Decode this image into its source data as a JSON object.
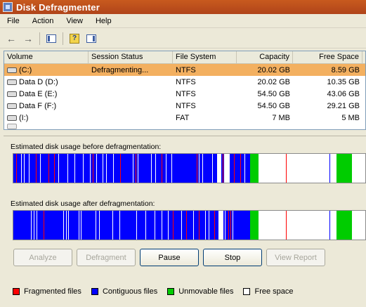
{
  "window": {
    "title": "Disk Defragmenter"
  },
  "menu": [
    "File",
    "Action",
    "View",
    "Help"
  ],
  "toolbar": {
    "icons": [
      "back-arrow-icon",
      "forward-arrow-icon",
      "show-hide-console-tree-icon",
      "help-icon",
      "properties-icon"
    ]
  },
  "table": {
    "columns": [
      "Volume",
      "Session Status",
      "File System",
      "Capacity",
      "Free Space"
    ],
    "rows": [
      {
        "volume": "(C:)",
        "status": "Defragmenting...",
        "fs": "NTFS",
        "capacity": "20.02 GB",
        "free": "8.59 GB",
        "selected": true
      },
      {
        "volume": "Data D (D:)",
        "status": "",
        "fs": "NTFS",
        "capacity": "20.02 GB",
        "free": "10.35 GB",
        "selected": false
      },
      {
        "volume": "Data E (E:)",
        "status": "",
        "fs": "NTFS",
        "capacity": "54.50 GB",
        "free": "43.06 GB",
        "selected": false
      },
      {
        "volume": "Data F (F:)",
        "status": "",
        "fs": "NTFS",
        "capacity": "54.50 GB",
        "free": "29.21 GB",
        "selected": false
      },
      {
        "volume": "(I:)",
        "status": "",
        "fs": "FAT",
        "capacity": "7 MB",
        "free": "5 MB",
        "selected": false
      }
    ]
  },
  "before_label": "Estimated disk usage before defragmentation:",
  "after_label": "Estimated disk usage after defragmentation:",
  "buttons": {
    "analyze": "Analyze",
    "defragment": "Defragment",
    "pause": "Pause",
    "stop": "Stop",
    "view_report": "View Report"
  },
  "legend": [
    {
      "label": "Fragmented files",
      "color": "#ff0000"
    },
    {
      "label": "Contiguous files",
      "color": "#0000ff"
    },
    {
      "label": "Unmovable files",
      "color": "#00cc00"
    },
    {
      "label": "Free space",
      "color": "#ffffff"
    }
  ],
  "colors": {
    "fragmented": "#ff0000",
    "contiguous": "#0000ff",
    "unmovable": "#00cc00",
    "free": "#ffffff",
    "title_bar": "#c04f1e",
    "selection": "#f3b060"
  }
}
